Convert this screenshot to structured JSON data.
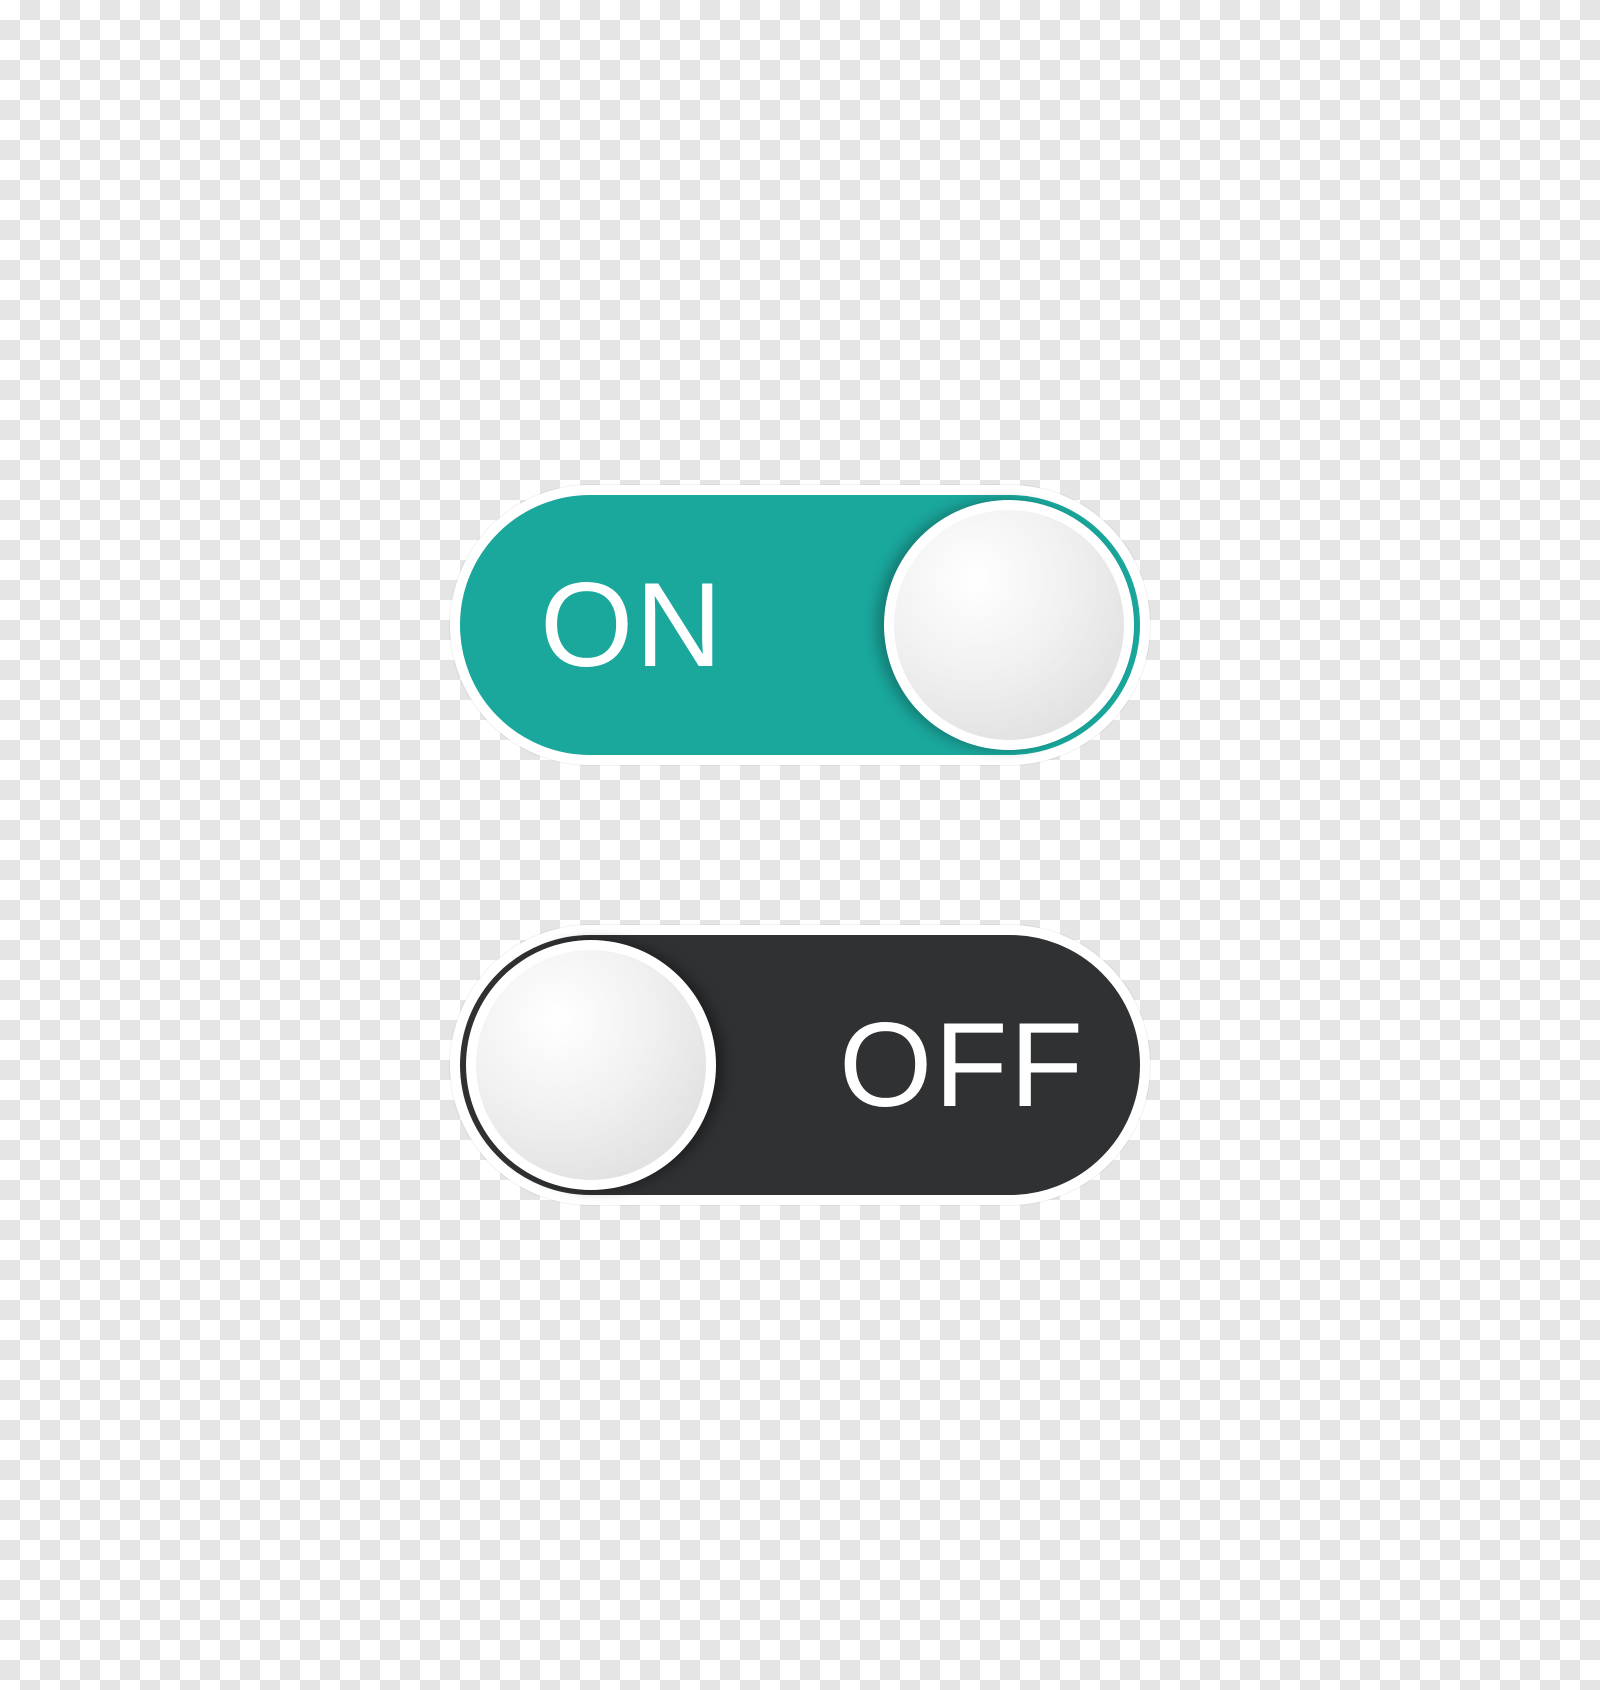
{
  "toggles": {
    "on": {
      "label": "ON",
      "bg": "#1aa79c"
    },
    "off": {
      "label": "OFF",
      "bg": "#2f3133"
    }
  }
}
